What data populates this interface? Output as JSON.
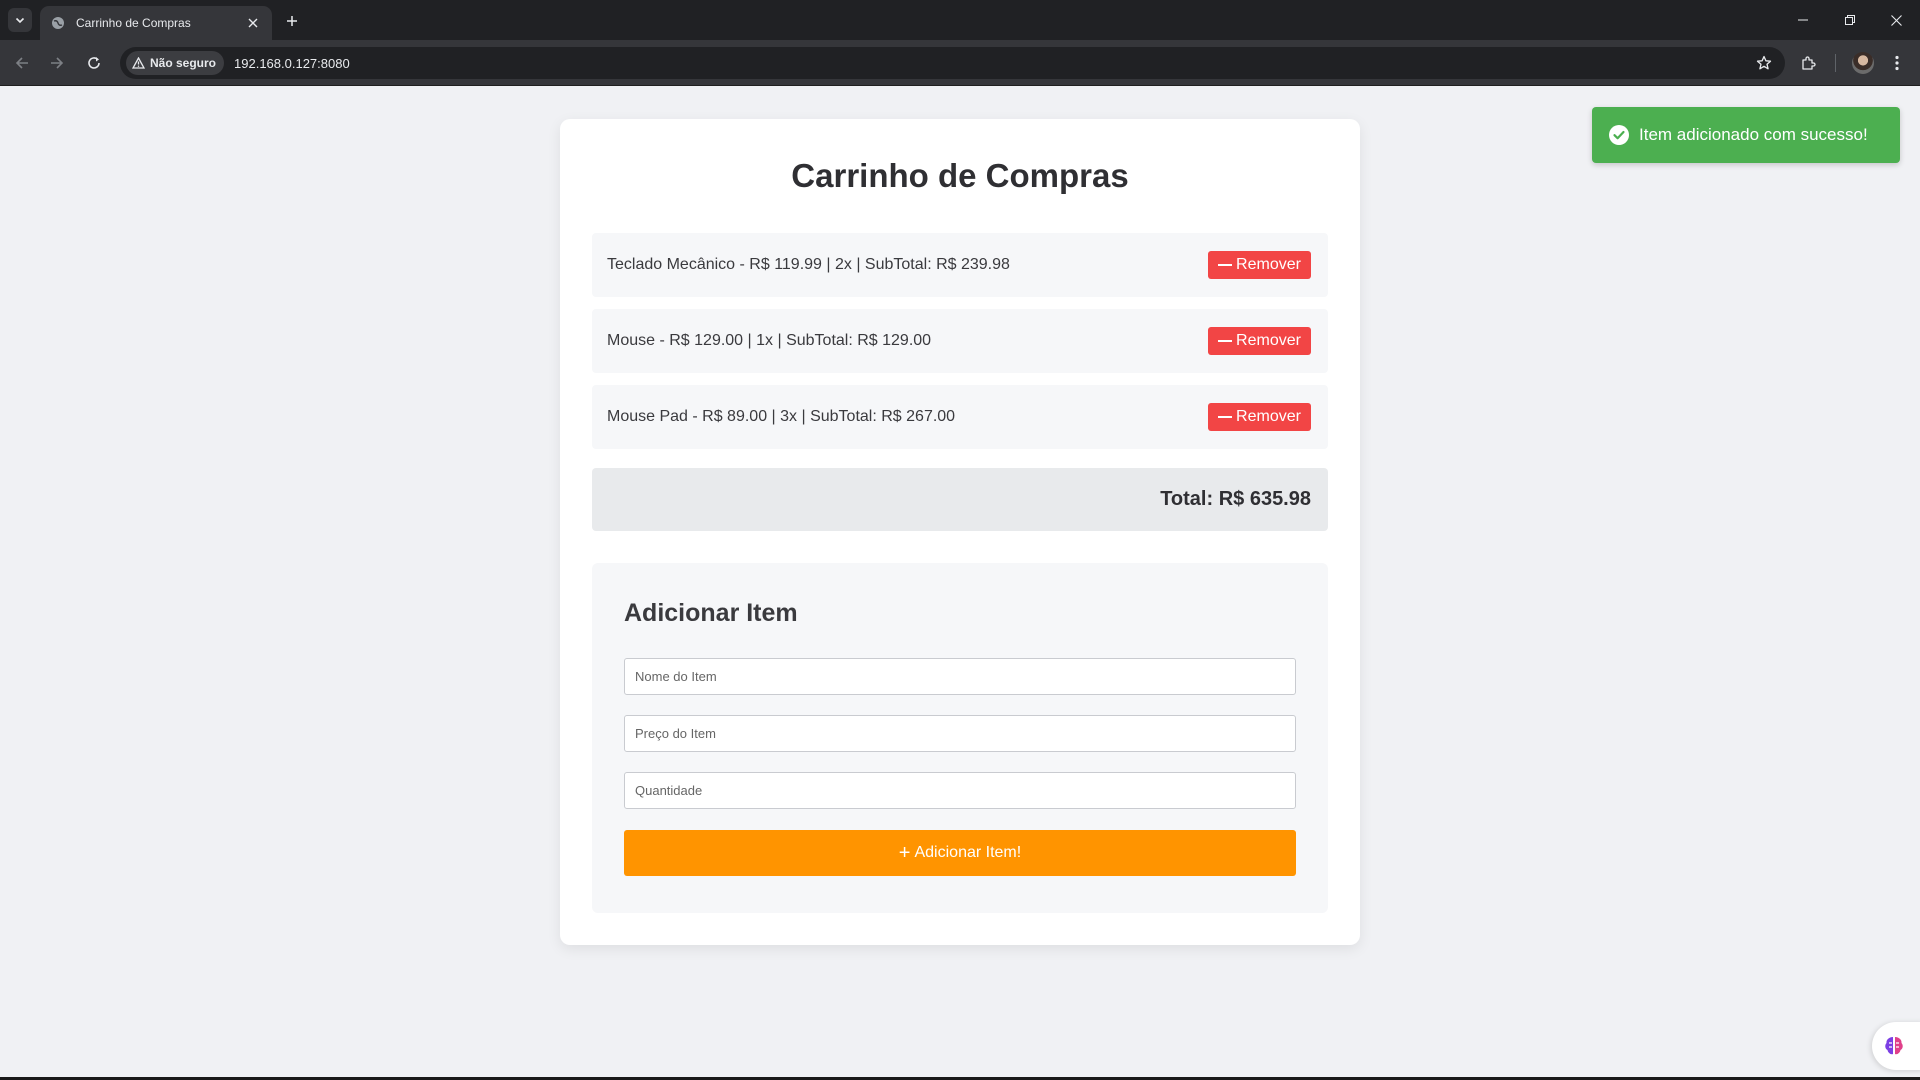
{
  "browser": {
    "tab_title": "Carrinho de Compras",
    "security_label": "Não seguro",
    "url": "192.168.0.127:8080"
  },
  "page": {
    "title": "Carrinho de Compras"
  },
  "cart": {
    "items": [
      {
        "text": "Teclado Mecânico - R$ 119.99 | 2x | SubTotal: R$ 239.98",
        "remove_label": "Remover"
      },
      {
        "text": "Mouse - R$ 129.00 | 1x | SubTotal: R$ 129.00",
        "remove_label": "Remover"
      },
      {
        "text": "Mouse Pad - R$ 89.00 | 3x | SubTotal: R$ 267.00",
        "remove_label": "Remover"
      }
    ],
    "total": "Total: R$ 635.98"
  },
  "form": {
    "title": "Adicionar Item",
    "name_placeholder": "Nome do Item",
    "price_placeholder": "Preço do Item",
    "quantity_placeholder": "Quantidade",
    "submit_label": "Adicionar Item!"
  },
  "toast": {
    "message": "Item adicionado com sucesso!"
  },
  "colors": {
    "remove": "#f24545",
    "add": "#ff9400",
    "toast": "#4caf50"
  }
}
